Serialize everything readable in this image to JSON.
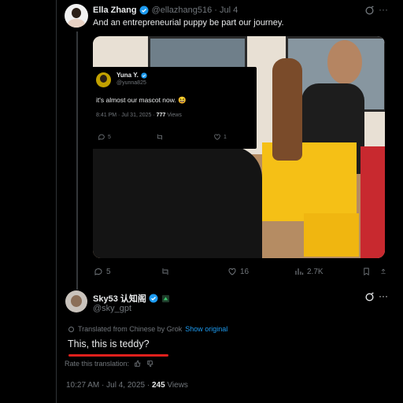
{
  "tweet": {
    "author_name": "Ella Zhang",
    "author_handle": "@ellazhang516",
    "date": "· Jul 4",
    "text": "And an entrepreneurial puppy be part our journey.",
    "stats": {
      "replies": "5",
      "likes": "16",
      "views": "2.7K"
    }
  },
  "quote": {
    "author_name": "Yuna Y.",
    "author_handle": "@yunna825",
    "text": "it's almost our mascot now. 😆",
    "meta_time": "8:41 PM · Jul 31, 2025 ·",
    "meta_views_count": "777",
    "meta_views_label": "Views",
    "stats": {
      "replies": "5",
      "likes": "1"
    }
  },
  "reply": {
    "author_name": "Sky53 认知阁",
    "author_handle": "@sky_gpt",
    "translated_label": "Translated from Chinese by Grok",
    "show_original": "Show original",
    "translation": "This, this is teddy?",
    "rate_label": "Rate this translation:",
    "timestamp": "10:27 AM · Jul 4, 2025 ·",
    "views_count": "245",
    "views_label": "Views"
  },
  "colors": {
    "accent": "#1d9bf0",
    "highlight": "#e0201c",
    "muted": "#71767b"
  }
}
